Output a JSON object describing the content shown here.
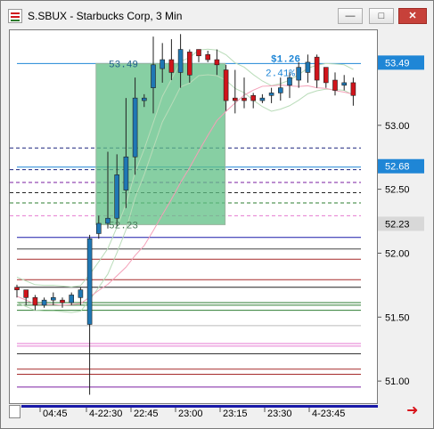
{
  "window": {
    "title": "S.SBUX - Starbucks Corp, 3 Min",
    "minimize_label": "—",
    "maximize_label": "□",
    "close_label": "✕"
  },
  "colors": {
    "up": "#1f77b4",
    "down": "#d0141b",
    "zone": "#5fbf84",
    "axis_label_bg": "#1f86d6",
    "current_label_bg": "#d8d8d8"
  },
  "price_axis": {
    "ticks": [
      "53.00",
      "52.50",
      "52.00",
      "51.50",
      "51.00"
    ],
    "labels": [
      {
        "text": "53.49",
        "style": "blue"
      },
      {
        "text": "52.68",
        "style": "blue"
      },
      {
        "text": "52.23",
        "style": "gray"
      }
    ]
  },
  "time_axis": {
    "ticks": [
      "04:45",
      "4-22:30",
      "22:45",
      "23:00",
      "23:15",
      "23:30",
      "4-23:45"
    ]
  },
  "chart_data": {
    "type": "candlestick",
    "title": "S.SBUX - Starbucks Corp, 3 Min",
    "ylim": [
      50.82,
      53.75
    ],
    "candles": [
      {
        "o": 51.74,
        "h": 51.76,
        "l": 51.66,
        "c": 51.72,
        "dir": "down"
      },
      {
        "o": 51.72,
        "h": 51.72,
        "l": 51.6,
        "c": 51.66,
        "dir": "down"
      },
      {
        "o": 51.66,
        "h": 51.68,
        "l": 51.56,
        "c": 51.6,
        "dir": "down"
      },
      {
        "o": 51.6,
        "h": 51.66,
        "l": 51.58,
        "c": 51.64,
        "dir": "up"
      },
      {
        "o": 51.64,
        "h": 51.7,
        "l": 51.6,
        "c": 51.66,
        "dir": "up"
      },
      {
        "o": 51.64,
        "h": 51.66,
        "l": 51.58,
        "c": 51.62,
        "dir": "down"
      },
      {
        "o": 51.62,
        "h": 51.7,
        "l": 51.6,
        "c": 51.68,
        "dir": "up"
      },
      {
        "o": 51.66,
        "h": 51.74,
        "l": 51.6,
        "c": 51.72,
        "dir": "up"
      },
      {
        "o": 51.45,
        "h": 52.15,
        "l": 50.9,
        "c": 52.12,
        "dir": "up"
      },
      {
        "o": 52.16,
        "h": 52.3,
        "l": 52.12,
        "c": 52.24,
        "dir": "up"
      },
      {
        "o": 52.24,
        "h": 52.8,
        "l": 52.2,
        "c": 52.28,
        "dir": "up"
      },
      {
        "o": 52.28,
        "h": 52.78,
        "l": 52.22,
        "c": 52.62,
        "dir": "up"
      },
      {
        "o": 52.5,
        "h": 53.22,
        "l": 52.36,
        "c": 52.76,
        "dir": "up"
      },
      {
        "o": 52.76,
        "h": 53.38,
        "l": 52.62,
        "c": 53.22,
        "dir": "up"
      },
      {
        "o": 53.22,
        "h": 53.25,
        "l": 53.15,
        "c": 53.2,
        "dir": "up"
      },
      {
        "o": 53.3,
        "h": 53.7,
        "l": 53.1,
        "c": 53.48,
        "dir": "up"
      },
      {
        "o": 53.45,
        "h": 53.65,
        "l": 53.34,
        "c": 53.52,
        "dir": "up"
      },
      {
        "o": 53.52,
        "h": 53.68,
        "l": 53.36,
        "c": 53.42,
        "dir": "down"
      },
      {
        "o": 53.42,
        "h": 53.72,
        "l": 53.3,
        "c": 53.6,
        "dir": "up"
      },
      {
        "o": 53.58,
        "h": 53.6,
        "l": 53.34,
        "c": 53.4,
        "dir": "down"
      },
      {
        "o": 53.6,
        "h": 53.6,
        "l": 53.5,
        "c": 53.55,
        "dir": "down"
      },
      {
        "o": 53.56,
        "h": 53.59,
        "l": 53.5,
        "c": 53.52,
        "dir": "down"
      },
      {
        "o": 53.52,
        "h": 53.6,
        "l": 53.4,
        "c": 53.48,
        "dir": "down"
      },
      {
        "o": 53.44,
        "h": 53.48,
        "l": 53.12,
        "c": 53.2,
        "dir": "down"
      },
      {
        "o": 53.2,
        "h": 53.44,
        "l": 53.1,
        "c": 53.22,
        "dir": "down"
      },
      {
        "o": 53.22,
        "h": 53.38,
        "l": 53.14,
        "c": 53.2,
        "dir": "down"
      },
      {
        "o": 53.24,
        "h": 53.26,
        "l": 53.14,
        "c": 53.2,
        "dir": "down"
      },
      {
        "o": 53.2,
        "h": 53.25,
        "l": 53.18,
        "c": 53.22,
        "dir": "up"
      },
      {
        "o": 53.24,
        "h": 53.3,
        "l": 53.18,
        "c": 53.26,
        "dir": "up"
      },
      {
        "o": 53.26,
        "h": 53.38,
        "l": 53.2,
        "c": 53.3,
        "dir": "up"
      },
      {
        "o": 53.32,
        "h": 53.42,
        "l": 53.22,
        "c": 53.38,
        "dir": "up"
      },
      {
        "o": 53.36,
        "h": 53.5,
        "l": 53.3,
        "c": 53.46,
        "dir": "up"
      },
      {
        "o": 53.42,
        "h": 53.56,
        "l": 53.34,
        "c": 53.5,
        "dir": "up"
      },
      {
        "o": 53.54,
        "h": 53.56,
        "l": 53.3,
        "c": 53.36,
        "dir": "down"
      },
      {
        "o": 53.46,
        "h": 53.46,
        "l": 53.3,
        "c": 53.34,
        "dir": "down"
      },
      {
        "o": 53.36,
        "h": 53.42,
        "l": 53.24,
        "c": 53.28,
        "dir": "down"
      },
      {
        "o": 53.32,
        "h": 53.4,
        "l": 53.28,
        "c": 53.34,
        "dir": "up"
      },
      {
        "o": 53.34,
        "h": 53.38,
        "l": 53.16,
        "c": 53.24,
        "dir": "down"
      }
    ],
    "horizontal_lines": [
      {
        "y": 53.49,
        "color": "#1f86d6",
        "dash": false
      },
      {
        "y": 52.83,
        "color": "#1a237e",
        "dash": true
      },
      {
        "y": 52.68,
        "color": "#1f86d6",
        "dash": false
      },
      {
        "y": 52.66,
        "color": "#1a237e",
        "dash": true
      },
      {
        "y": 52.56,
        "color": "#7b1fa2",
        "dash": true
      },
      {
        "y": 52.48,
        "color": "#222222",
        "dash": true
      },
      {
        "y": 52.4,
        "color": "#2e7d32",
        "dash": true
      },
      {
        "y": 52.3,
        "color": "#e57ad0",
        "dash": true
      },
      {
        "y": 52.13,
        "color": "#1a1aa8",
        "dash": false
      },
      {
        "y": 52.04,
        "color": "#444444",
        "dash": false
      },
      {
        "y": 51.96,
        "color": "#a52a2a",
        "dash": false
      },
      {
        "y": 51.8,
        "color": "#a52a2a",
        "dash": false
      },
      {
        "y": 51.74,
        "color": "#222222",
        "dash": false
      },
      {
        "y": 51.62,
        "color": "#2e7d32",
        "dash": false
      },
      {
        "y": 51.6,
        "color": "#2e7d32",
        "dash": false
      },
      {
        "y": 51.56,
        "color": "#2e7d32",
        "dash": false
      },
      {
        "y": 51.44,
        "color": "#bbbbbb",
        "dash": false
      },
      {
        "y": 51.3,
        "color": "#e57ad0",
        "dash": false
      },
      {
        "y": 51.28,
        "color": "#e57ad0",
        "dash": false
      },
      {
        "y": 51.22,
        "color": "#333333",
        "dash": false
      },
      {
        "y": 51.1,
        "color": "#a52a2a",
        "dash": false
      },
      {
        "y": 51.06,
        "color": "#a52a2a",
        "dash": false
      },
      {
        "y": 50.96,
        "color": "#7b1fa2",
        "dash": false
      }
    ],
    "zone": {
      "top": 53.49,
      "bottom": 52.23,
      "start_index": 9,
      "end_index": 23
    },
    "annotations": [
      {
        "text": "53.49",
        "at": 53.49
      },
      {
        "text": "52.23",
        "at": 52.23
      },
      {
        "text": "$1.26",
        "at": 53.53
      },
      {
        "text": "2.41%",
        "at": 53.42
      }
    ]
  }
}
